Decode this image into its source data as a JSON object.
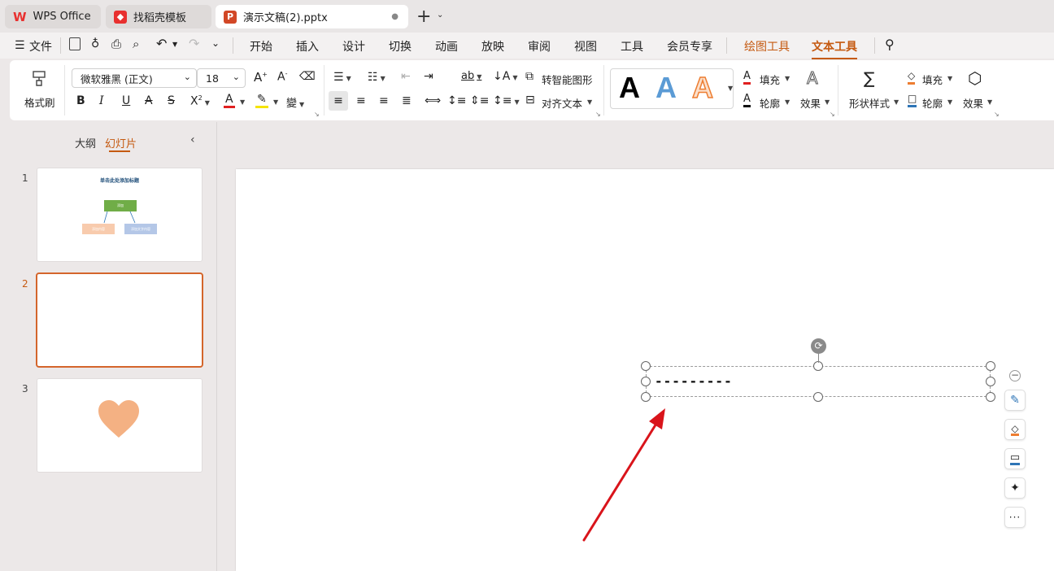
{
  "tabs": [
    {
      "label": "WPS Office",
      "icon": "wps-logo-icon"
    },
    {
      "label": "找稻壳模板",
      "icon": "docer-icon"
    },
    {
      "label": "演示文稿(2).pptx",
      "icon": "presentation-file-icon",
      "active": true
    }
  ],
  "menu": {
    "file_label": "文件",
    "items": [
      "开始",
      "插入",
      "设计",
      "切换",
      "动画",
      "放映",
      "审阅",
      "视图",
      "工具",
      "会员专享"
    ],
    "context_tabs": [
      "绘图工具",
      "文本工具"
    ],
    "active_tab": "文本工具"
  },
  "ribbon": {
    "format_painter": "格式刷",
    "font_name": "微软雅黑 (正文)",
    "font_size": "18",
    "smart_graphic": "转智能图形",
    "align_text": "对齐文本",
    "fill": "填充",
    "outline": "轮廓",
    "effect": "效果",
    "shape_style": "形状样式",
    "shape_fill": "填充",
    "shape_outline": "轮廓",
    "shape_effect": "效果",
    "art_letters": [
      "A",
      "A",
      "A"
    ],
    "font_color": "#e02020",
    "highlight_color": "#f5e400",
    "accent": "#c55a11"
  },
  "panel": {
    "tab_outline": "大纲",
    "tab_slides": "幻灯片",
    "active_tab": "幻灯片",
    "slides": [
      {
        "number": "1",
        "title": "单击此处添加标题",
        "box_top": "添加",
        "box_left": "添加内容",
        "box_right": "添加文字内容"
      },
      {
        "number": "2",
        "selected": true
      },
      {
        "number": "3",
        "shape": "heart",
        "shape_color": "#f4b183"
      }
    ]
  },
  "canvas": {
    "textbox_text": "---------",
    "arrow_color": "#d9141b"
  }
}
